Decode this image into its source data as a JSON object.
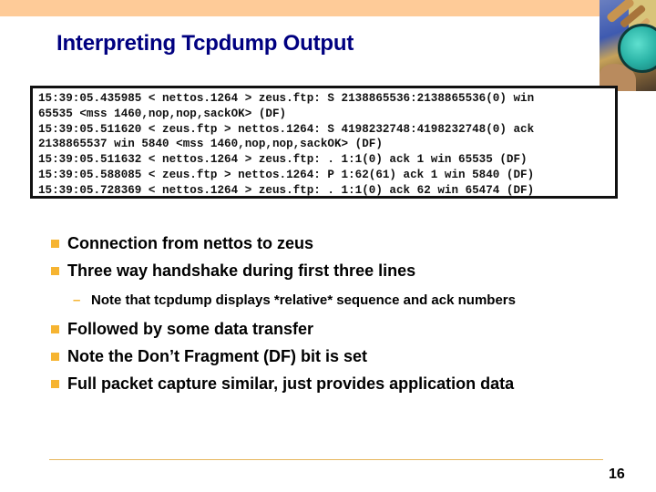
{
  "slide": {
    "title": "Interpreting Tcpdump Output",
    "page_number": "16",
    "colors": {
      "title": "#000080",
      "top_band": "#fecb98",
      "bullet": "#f6b431",
      "footer_rule": "#e7b75e"
    }
  },
  "terminal": {
    "lines": [
      "15:39:05.435985 < nettos.1264 > zeus.ftp: S 2138865536:2138865536(0) win",
      "65535 <mss 1460,nop,nop,sackOK> (DF)",
      "15:39:05.511620 < zeus.ftp > nettos.1264: S 4198232748:4198232748(0) ack",
      "2138865537 win 5840 <mss 1460,nop,nop,sackOK> (DF)",
      "15:39:05.511632 < nettos.1264 > zeus.ftp: . 1:1(0) ack 1 win 65535 (DF)",
      "15:39:05.588085 < zeus.ftp > nettos.1264: P 1:62(61) ack 1 win 5840 (DF)",
      "15:39:05.728369 < nettos.1264 > zeus.ftp: . 1:1(0) ack 62 win 65474 (DF)"
    ]
  },
  "bullets": [
    {
      "text": "Connection from nettos to zeus"
    },
    {
      "text": "Three way handshake during first three lines",
      "sub": "Note that tcpdump displays *relative* sequence and ack numbers"
    },
    {
      "text": "Followed by some data transfer"
    },
    {
      "text": "Note the Don’t Fragment (DF) bit is set"
    },
    {
      "text": "Full packet capture similar, just provides application data"
    }
  ],
  "icons": {
    "corner_image": "magnifying-glass-photo",
    "bullet": "square-bullet",
    "sub_bullet": "dash-bullet"
  }
}
